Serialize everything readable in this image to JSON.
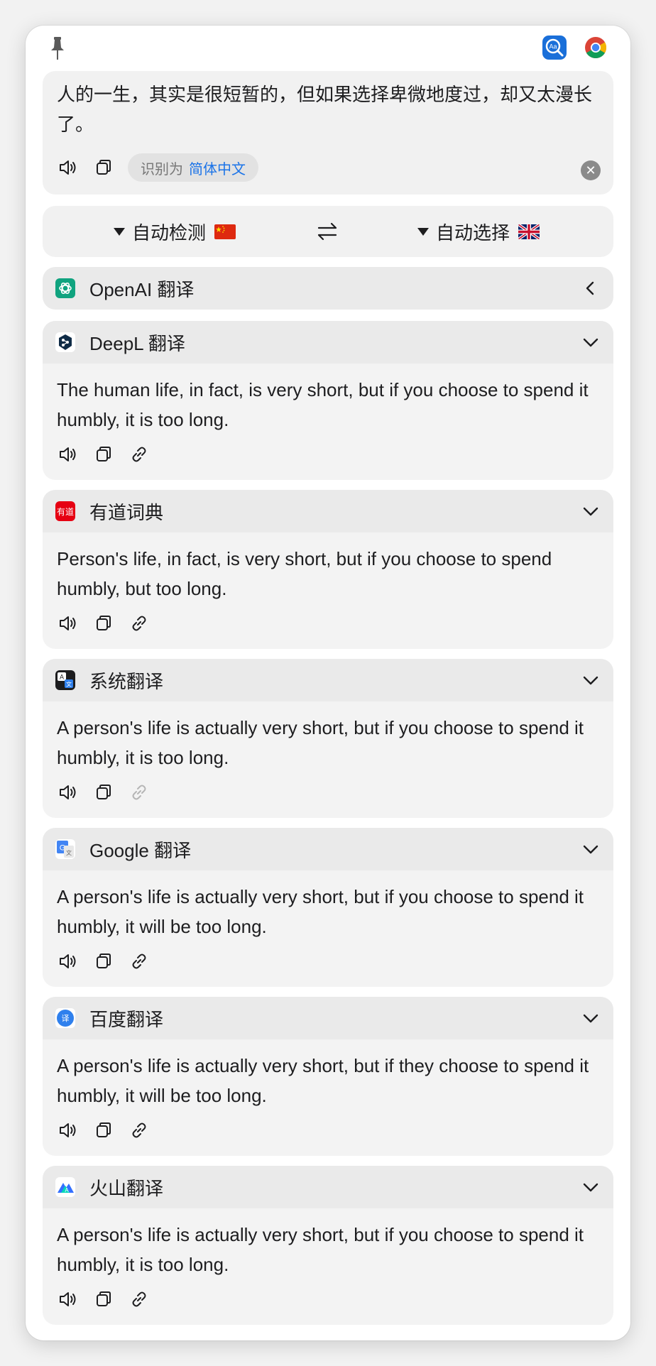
{
  "input": {
    "text": "人的一生，其实是很短暂的，但如果选择卑微地度过，却又太漫长了。",
    "detected_prefix": "识别为",
    "detected_language": "简体中文"
  },
  "languages": {
    "from": "自动检测",
    "to": "自动选择"
  },
  "services": [
    {
      "name": "OpenAI 翻译",
      "icon": "openai-icon",
      "expanded": false
    },
    {
      "name": "DeepL 翻译",
      "icon": "deepl-icon",
      "expanded": true,
      "result": "The human life, in fact, is very short, but if you choose to spend it humbly, it is too long."
    },
    {
      "name": "有道词典",
      "icon": "youdao-icon",
      "logo_text": "有道",
      "expanded": true,
      "result": "Person's life, in fact, is very short, but if you choose to spend humbly, but too long."
    },
    {
      "name": "系统翻译",
      "icon": "system-translate-icon",
      "expanded": true,
      "result": "A person's life is actually very short, but if you choose to spend it humbly, it is too long."
    },
    {
      "name": "Google 翻译",
      "icon": "google-translate-icon",
      "expanded": true,
      "result": "A person's life is actually very short, but if you choose to spend it humbly, it will be too long."
    },
    {
      "name": "百度翻译",
      "icon": "baidu-translate-icon",
      "expanded": true,
      "result": "A person's life is actually very short, but if they choose to spend it humbly, it will be too long."
    },
    {
      "name": "火山翻译",
      "icon": "volcano-translate-icon",
      "expanded": true,
      "result": "A person's life is actually very short, but if you choose to spend it humbly, it is too long."
    }
  ],
  "colors": {
    "accent": "#1a73e8",
    "card_bg": "#f3f3f3",
    "header_bg": "#eaeaea"
  }
}
